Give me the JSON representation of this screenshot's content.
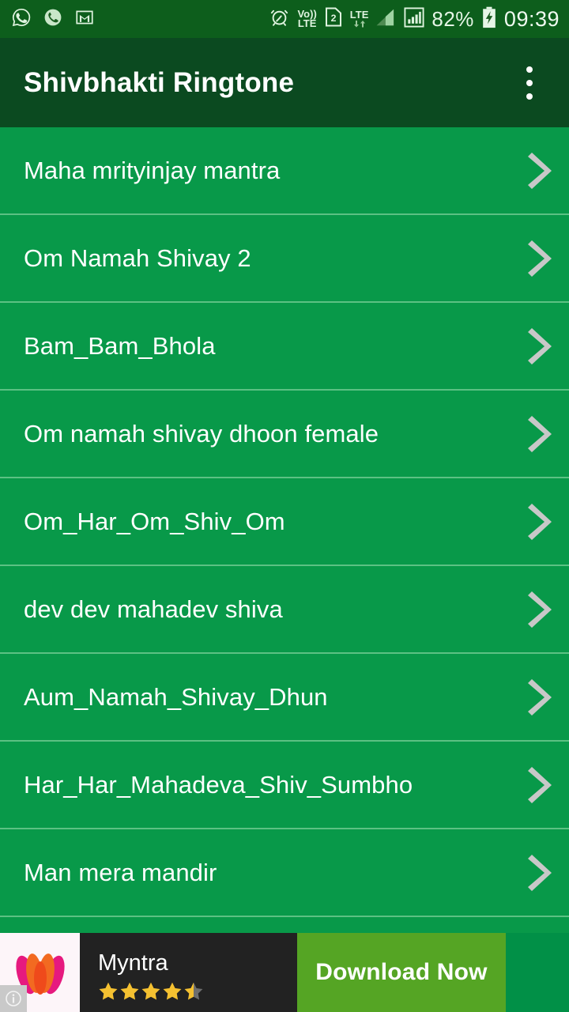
{
  "status_bar": {
    "left_icons": [
      "whatsapp-icon",
      "missed-call-icon",
      "gmail-icon"
    ],
    "right_icons": [
      "alarm-icon",
      "volte-icon",
      "sim2-icon",
      "lte-data-icon",
      "signal-sim1-icon",
      "signal-sim2-icon"
    ],
    "volte_label_top": "Vo))",
    "volte_label_bottom": "LTE",
    "sim_label": "2",
    "lte_label": "LTE",
    "battery_percent": "82%",
    "battery_state": "charging-bolt-icon",
    "clock": "09:39"
  },
  "action_bar": {
    "title": "Shivbhakti Ringtone",
    "overflow_icon": "more-vertical-icon"
  },
  "list": {
    "items": [
      {
        "label": "Maha mrityinjay mantra",
        "chevron": "chevron-right-icon"
      },
      {
        "label": "Om Namah Shivay 2",
        "chevron": "chevron-right-icon"
      },
      {
        "label": "Bam_Bam_Bhola",
        "chevron": "chevron-right-icon"
      },
      {
        "label": "Om namah shivay dhoon female",
        "chevron": "chevron-right-icon"
      },
      {
        "label": "Om_Har_Om_Shiv_Om",
        "chevron": "chevron-right-icon"
      },
      {
        "label": "dev dev mahadev shiva",
        "chevron": "chevron-right-icon"
      },
      {
        "label": "Aum_Namah_Shivay_Dhun",
        "chevron": "chevron-right-icon"
      },
      {
        "label": "Har_Har_Mahadeva_Shiv_Sumbho",
        "chevron": "chevron-right-icon"
      },
      {
        "label": "Man mera mandir",
        "chevron": "chevron-right-icon"
      }
    ]
  },
  "ad_banner": {
    "advertiser": "Myntra",
    "logo_icon": "myntra-m-logo",
    "info_icon": "ad-info-icon",
    "rating": 4.5,
    "rating_max": 5,
    "cta_label": "Download Now"
  },
  "colors": {
    "status_bar_bg": "#0d5e1c",
    "action_bar_bg": "#0b4a20",
    "list_bg": "#089949",
    "list_divider": "#5cc183",
    "list_text": "#ffffff",
    "chevron": "#c8c8c8",
    "ad_body_bg": "#222222",
    "ad_cta_bg": "#55a524",
    "star_gold": "#f5c131",
    "star_empty": "#6e6e6e"
  }
}
